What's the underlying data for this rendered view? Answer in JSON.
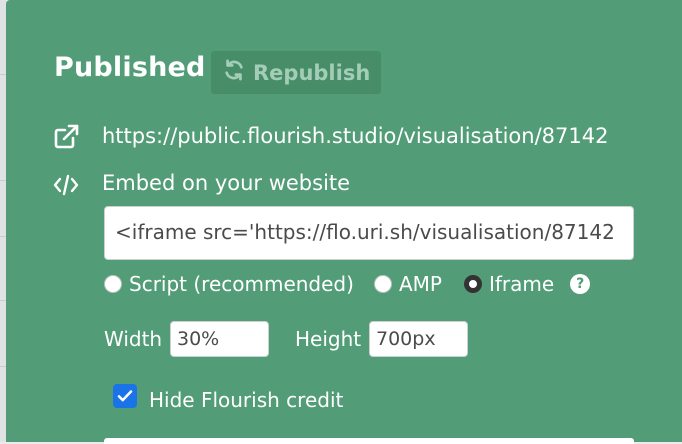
{
  "header": {
    "title": "Published",
    "republish_label": "Republish"
  },
  "link": {
    "url": "https://public.flourish.studio/visualisation/87142"
  },
  "embed": {
    "label": "Embed on your website",
    "code": "<iframe src='https://flo.uri.sh/visualisation/87142"
  },
  "embed_type": {
    "options": [
      "Script (recommended)",
      "AMP",
      "Iframe"
    ],
    "selected": "Iframe",
    "help_icon": "?"
  },
  "dimensions": {
    "width_label": "Width",
    "width_value": "30%",
    "height_label": "Height",
    "height_value": "700px"
  },
  "credit": {
    "label": "Hide Flourish credit",
    "checked": true
  },
  "colors": {
    "panel": "#529d77",
    "button": "#468d68",
    "checkbox": "#1a73e8"
  },
  "icons": {
    "republish": "refresh-icon",
    "link": "external-link-icon",
    "embed": "code-icon"
  }
}
